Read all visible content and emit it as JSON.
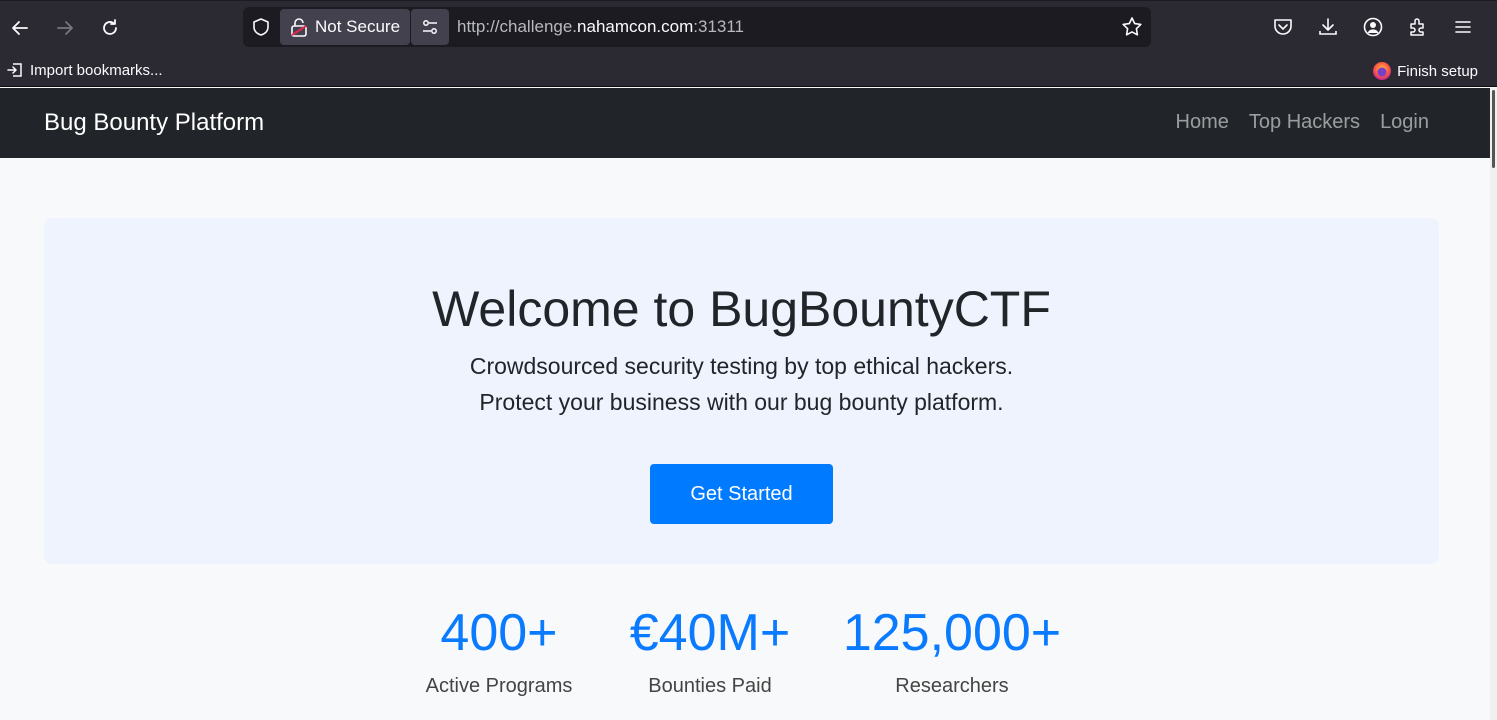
{
  "browser": {
    "security_label": "Not Secure",
    "url_prefix": "http://challenge.",
    "url_domain": "nahamcon.com",
    "url_suffix": ":31311",
    "bookmarks": {
      "import_label": "Import bookmarks...",
      "finish_label": "Finish setup"
    }
  },
  "site": {
    "brand": "Bug Bounty Platform",
    "nav": [
      "Home",
      "Top Hackers",
      "Login"
    ]
  },
  "hero": {
    "title": "Welcome to BugBountyCTF",
    "lead_line1": "Crowdsourced security testing by top ethical hackers.",
    "lead_line2": "Protect your business with our bug bounty platform.",
    "cta": "Get Started"
  },
  "stats": [
    {
      "value": "400+",
      "label": "Active Programs"
    },
    {
      "value": "€40M+",
      "label": "Bounties Paid"
    },
    {
      "value": "125,000+",
      "label": "Researchers"
    }
  ],
  "colors": {
    "accent": "#007bff",
    "navbar_bg": "#212529",
    "hero_bg": "#eef3fd"
  }
}
